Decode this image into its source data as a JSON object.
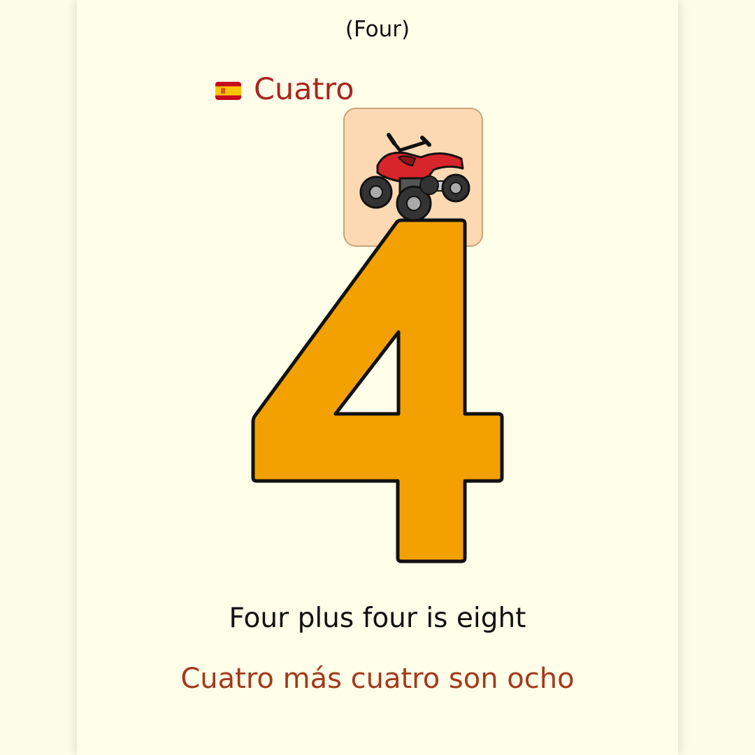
{
  "header": {
    "english_word": "(Four)",
    "spanish_word": "Cuatro",
    "flag_icon": "spain-flag-icon"
  },
  "illustration": {
    "icon": "atv-quad-bike-icon",
    "numeral": "4"
  },
  "sentences": {
    "english": "Four plus four is eight",
    "spanish": "Cuatro más cuatro son ocho"
  },
  "colors": {
    "page_background": "#fefee9",
    "numeral_fill": "#f2a100",
    "spanish_text": "#a8261f",
    "tile_background": "#fcd9b2"
  }
}
